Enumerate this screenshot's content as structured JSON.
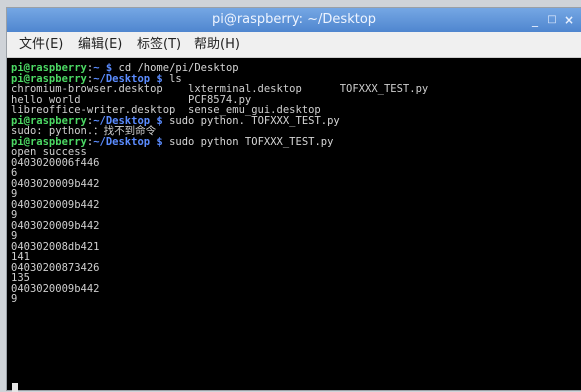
{
  "window": {
    "title": "pi@raspberry: ~/Desktop",
    "controls": {
      "minimize": "_",
      "maximize": "□",
      "close": "×"
    }
  },
  "menu": [
    "文件(E)",
    "编辑(E)",
    "标签(T)",
    "帮助(H)"
  ],
  "terminal": {
    "user_host": "pi@raspberry",
    "lines": [
      {
        "type": "prompt",
        "path": "~",
        "cmd": " cd /home/pi/Desktop"
      },
      {
        "type": "prompt",
        "path": "~/Desktop",
        "cmd": " ls"
      },
      {
        "type": "out",
        "text": "chromium-browser.desktop    lxterminal.desktop      TOFXXX_TEST.py"
      },
      {
        "type": "out",
        "text": "hello world                 PCF8574.py"
      },
      {
        "type": "out",
        "text": "libreoffice-writer.desktop  sense_emu_gui.desktop"
      },
      {
        "type": "prompt",
        "path": "~/Desktop",
        "cmd": " sudo python. TOFXXX_TEST.py"
      },
      {
        "type": "out",
        "text": "sudo: python.：找不到命令"
      },
      {
        "type": "prompt",
        "path": "~/Desktop",
        "cmd": " sudo python TOFXXX_TEST.py"
      },
      {
        "type": "out",
        "text": "open success"
      },
      {
        "type": "out",
        "text": "0403020006f446"
      },
      {
        "type": "out",
        "text": "6"
      },
      {
        "type": "out",
        "text": "0403020009b442"
      },
      {
        "type": "out",
        "text": "9"
      },
      {
        "type": "out",
        "text": "0403020009b442"
      },
      {
        "type": "out",
        "text": "9"
      },
      {
        "type": "out",
        "text": "0403020009b442"
      },
      {
        "type": "out",
        "text": "9"
      },
      {
        "type": "out",
        "text": "040302008db421"
      },
      {
        "type": "out",
        "text": "141"
      },
      {
        "type": "out",
        "text": "04030200873426"
      },
      {
        "type": "out",
        "text": "135"
      },
      {
        "type": "out",
        "text": "0403020009b442"
      },
      {
        "type": "out",
        "text": "9"
      }
    ]
  }
}
